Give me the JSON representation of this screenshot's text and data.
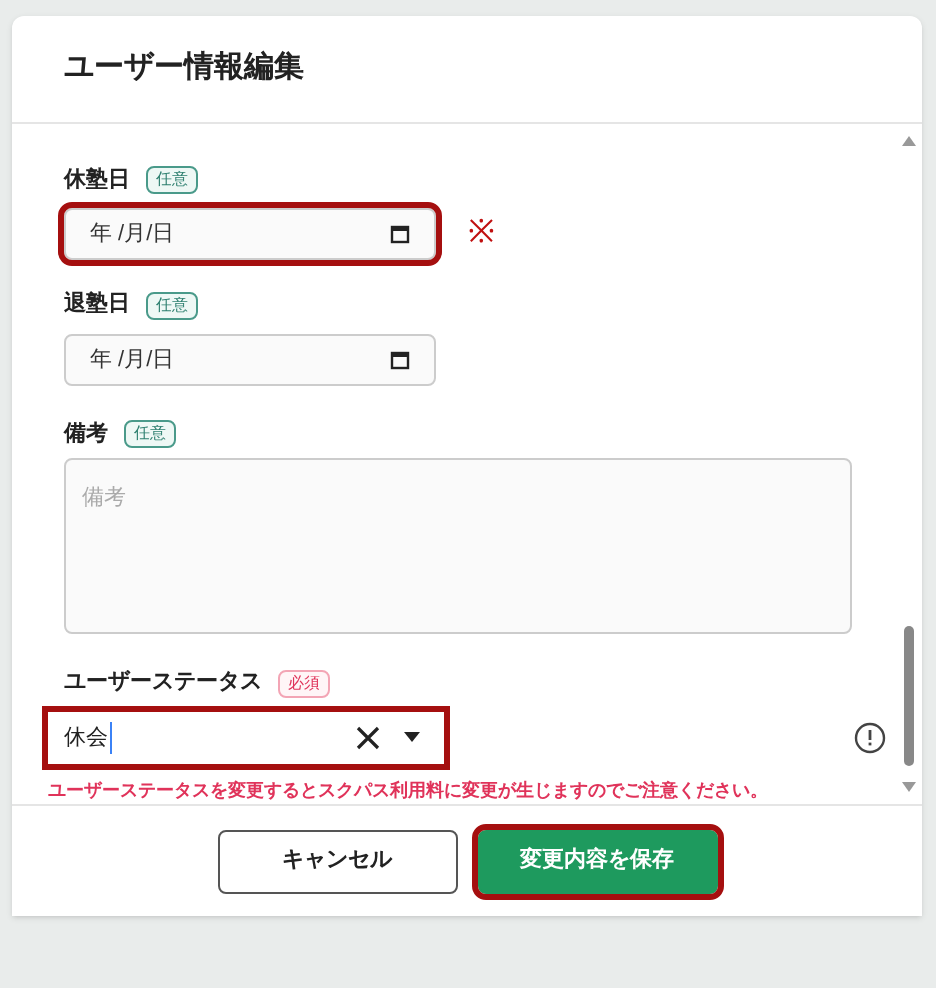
{
  "dialog": {
    "title": "ユーザー情報編集"
  },
  "fields": [
    {
      "kind": "date",
      "label": "休塾日",
      "badge": {
        "text": "任意",
        "kind": "optional"
      },
      "placeholder": "年 /月/日",
      "highlighted": true,
      "note": "※"
    },
    {
      "kind": "date",
      "label": "退塾日",
      "badge": {
        "text": "任意",
        "kind": "optional"
      },
      "placeholder": "年 /月/日",
      "highlighted": false
    },
    {
      "kind": "textarea",
      "label": "備考",
      "badge": {
        "text": "任意",
        "kind": "optional"
      },
      "placeholder": "備考",
      "highlighted": false
    },
    {
      "kind": "select",
      "label": "ユーザーステータス",
      "badge": {
        "text": "必須",
        "kind": "required"
      },
      "value": "休会",
      "highlighted": true,
      "warning": "ユーザーステータスを変更するとスクパス利用料に変更が生じますのでご注意ください。"
    }
  ],
  "buttons": [
    {
      "label": "キャンセル",
      "kind": "secondary",
      "highlighted": false
    },
    {
      "label": "変更内容を保存",
      "kind": "primary",
      "highlighted": true
    }
  ]
}
